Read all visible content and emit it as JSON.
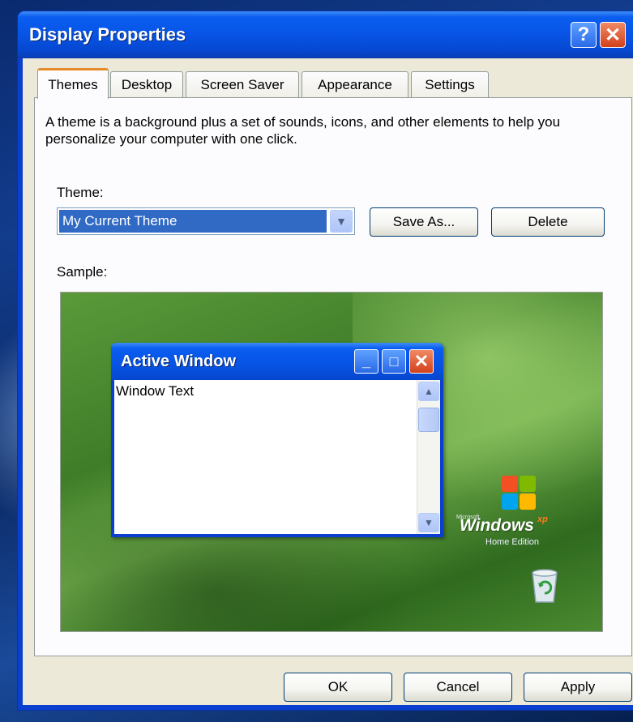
{
  "window": {
    "title": "Display Properties",
    "help_label": "?",
    "close_label": "✕"
  },
  "tabs": [
    {
      "label": "Themes",
      "active": true
    },
    {
      "label": "Desktop",
      "active": false
    },
    {
      "label": "Screen Saver",
      "active": false
    },
    {
      "label": "Appearance",
      "active": false
    },
    {
      "label": "Settings",
      "active": false
    }
  ],
  "themes": {
    "description": "A theme is a background plus a set of sounds, icons, and other elements to help you personalize your computer with one click.",
    "theme_label": "Theme:",
    "theme_value": "My Current Theme",
    "save_as_label": "Save As...",
    "delete_label": "Delete",
    "sample_label": "Sample:"
  },
  "sample": {
    "window_title": "Active Window",
    "window_text": "Window Text",
    "logo_small": "Microsoft",
    "logo_word": "Windows",
    "logo_xp": "xp",
    "logo_edition": "Home Edition"
  },
  "footer": {
    "ok_label": "OK",
    "cancel_label": "Cancel",
    "apply_label": "Apply"
  },
  "colors": {
    "titlebar": "#0754e6",
    "dialog_face": "#ece9d8",
    "selection": "#316ac5",
    "tab_highlight": "#e68b2c"
  }
}
